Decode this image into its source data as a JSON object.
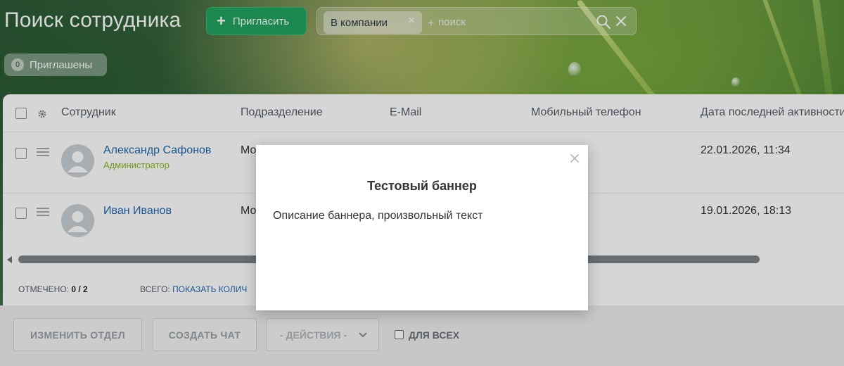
{
  "header": {
    "title": "Поиск сотрудника",
    "invite_button": "Пригласить",
    "filter_chip": "В компании",
    "search_placeholder": "поиск",
    "invited": {
      "count": "0",
      "label": "Приглашены"
    }
  },
  "grid": {
    "columns": [
      "Сотрудник",
      "Подразделение",
      "E-Mail",
      "Мобильный телефон",
      "Дата последней активности"
    ],
    "rows": [
      {
        "name": "Александр Сафонов",
        "role": "Администратор",
        "department": "Мо",
        "last_activity": "22.01.2026, 11:34"
      },
      {
        "name": "Иван Иванов",
        "role": "",
        "department": "Мо",
        "last_activity": "19.01.2026, 18:13"
      }
    ],
    "footer": {
      "checked_label": "ОТМЕЧЕНО:",
      "checked_value": "0 / 2",
      "total_label": "ВСЕГО:",
      "total_link": "ПОКАЗАТЬ КОЛИЧ"
    }
  },
  "actions": {
    "change_department": "ИЗМЕНИТЬ ОТДЕЛ",
    "create_chat": "СОЗДАТЬ ЧАТ",
    "actions_select": "- ДЕЙСТВИЯ -",
    "for_all": "ДЛЯ ВСЕХ"
  },
  "banner": {
    "title": "Тестовый баннер",
    "text": "Описание баннера, произвольный текст"
  },
  "colors": {
    "accent_green": "#21a35f",
    "link_blue": "#2067b0",
    "role_green": "#88b218"
  }
}
